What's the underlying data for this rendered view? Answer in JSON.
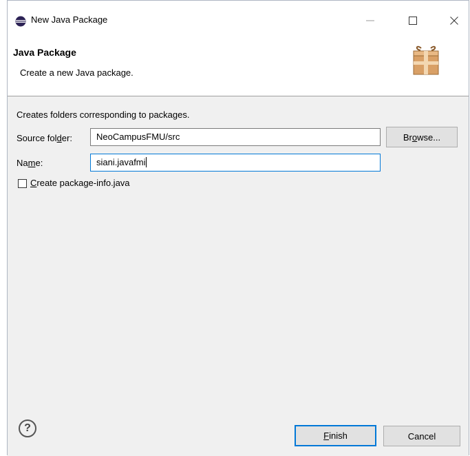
{
  "window": {
    "title": "New Java Package",
    "controls": {
      "minimize": "—",
      "maximize": "☐",
      "close": "✕"
    }
  },
  "header": {
    "title": "Java Package",
    "description": "Create a new Java package."
  },
  "form": {
    "intro": "Creates folders corresponding to packages.",
    "source_folder": {
      "label_before": "Source fol",
      "label_mnemonic": "d",
      "label_after": "er:",
      "value": "NeoCampusFMU/src"
    },
    "browse_label": {
      "before": "Br",
      "mnemonic": "o",
      "after": "wse..."
    },
    "name": {
      "label_before": "Na",
      "label_mnemonic": "m",
      "label_after": "e:",
      "value": "siani.javafmi"
    },
    "create_package_info": {
      "label_mnemonic": "C",
      "label_after": "reate package-info.java",
      "checked": false
    }
  },
  "footer": {
    "help_glyph": "?",
    "finish": {
      "mnemonic": "F",
      "after": "inish"
    },
    "cancel_label": "Cancel"
  },
  "colors": {
    "accent": "#0078d7",
    "dialog_bg": "#f0f0f0",
    "button_bg": "#e1e1e1"
  }
}
